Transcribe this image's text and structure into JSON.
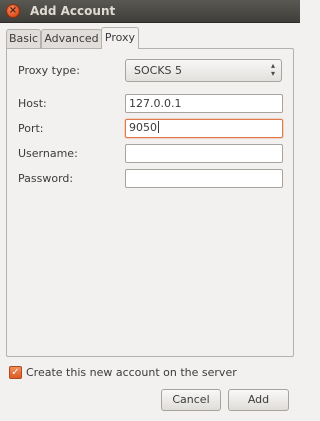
{
  "window": {
    "title": "Add Account",
    "close_glyph": "×"
  },
  "tabs": [
    {
      "label": "Basic"
    },
    {
      "label": "Advanced"
    },
    {
      "label": "Proxy"
    }
  ],
  "proxy": {
    "proxy_type_label": "Proxy type:",
    "proxy_type_value": "SOCKS 5",
    "combo_arrows": "▴▾",
    "host_label": "Host:",
    "host_value": "127.0.0.1",
    "port_label": "Port:",
    "port_value": "9050",
    "username_label": "Username:",
    "username_value": "",
    "password_label": "Password:",
    "password_value": ""
  },
  "footer": {
    "create_checkbox_label": "Create this new account on the server",
    "create_checkbox_checked": true,
    "check_glyph": "✓",
    "cancel_label": "Cancel",
    "add_label": "Add"
  },
  "colors": {
    "accent": "#dd5a24",
    "titlebar": "#3f3e3a",
    "background": "#f2f1f0"
  },
  "icons": [
    "close-icon",
    "up-down-arrows-icon",
    "checkmark-icon"
  ]
}
